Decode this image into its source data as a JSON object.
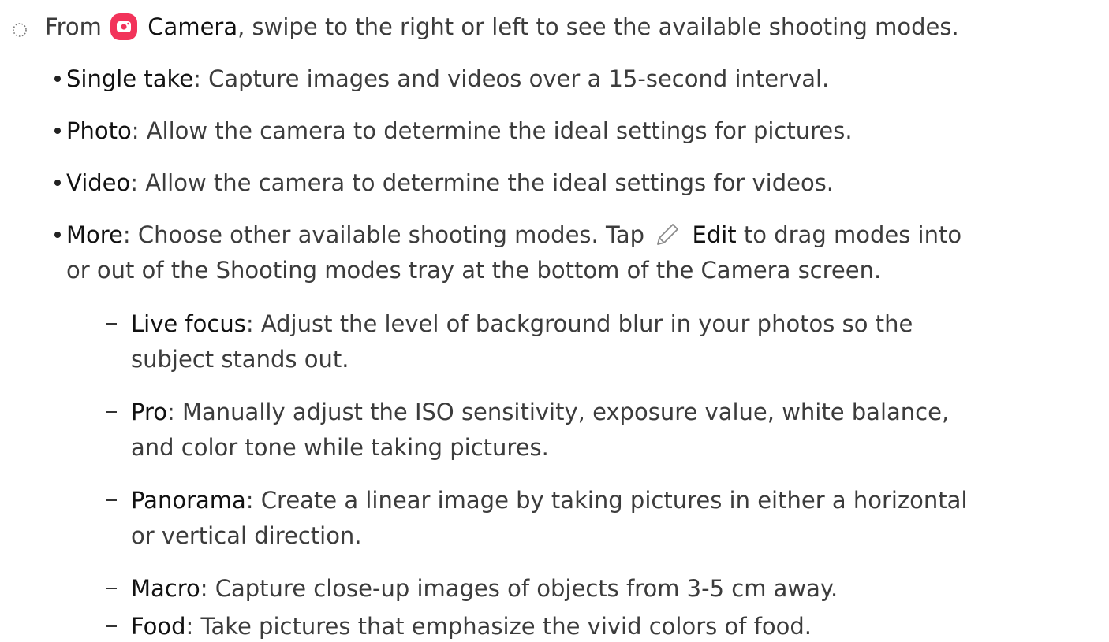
{
  "step": {
    "from": "From",
    "camera_label": "Camera",
    "rest": ", swipe to the right or left to see the available shooting modes."
  },
  "modes": [
    {
      "term": "Single take",
      "desc": ": Capture images and videos over a 15-second interval."
    },
    {
      "term": "Photo",
      "desc": ": Allow the camera to determine the ideal settings for pictures."
    },
    {
      "term": "Video",
      "desc": ": Allow the camera to determine the ideal settings for videos."
    },
    {
      "term": "More",
      "desc_before": ": Choose other available shooting modes. Tap",
      "edit_label": "Edit",
      "desc_after": " to drag modes into",
      "desc_line2": "or out of the Shooting modes tray at the bottom of the Camera screen."
    }
  ],
  "more_modes": [
    {
      "term": "Live focus",
      "desc": ": Adjust the level of background blur in your photos so the",
      "desc_line2": "subject stands out."
    },
    {
      "term": "Pro",
      "desc": ": Manually adjust the ISO sensitivity, exposure value, white balance,",
      "desc_line2": "and color tone while taking pictures."
    },
    {
      "term": "Panorama",
      "desc": ": Create a linear image by taking pictures in either a horizontal",
      "desc_line2": "or vertical direction."
    },
    {
      "term": "Macro",
      "desc": ": Capture close-up images of objects from 3-5 cm away."
    },
    {
      "term": "Food",
      "desc": ": Take pictures that emphasize the vivid colors of food."
    }
  ],
  "icons": {
    "step": "dotted-circle-icon",
    "camera": "camera-app-icon",
    "edit": "pencil-edit-icon"
  },
  "colors": {
    "camera_icon": "#f2335a",
    "text": "#3c3c3c",
    "term": "#111111"
  }
}
